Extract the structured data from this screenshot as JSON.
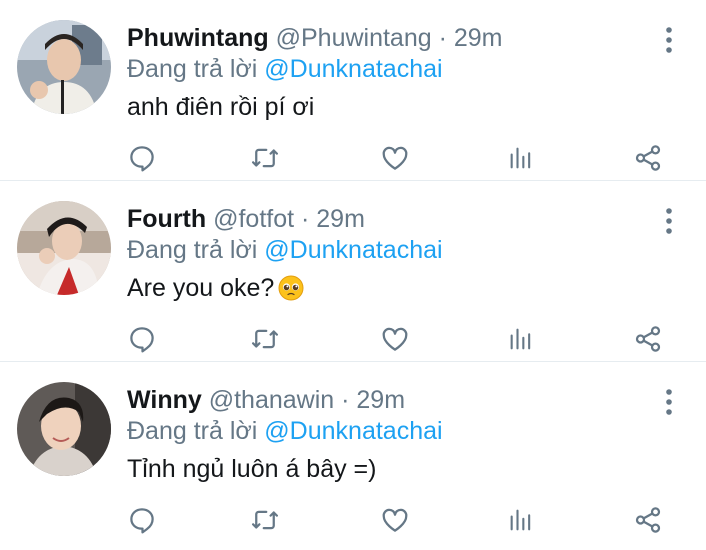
{
  "reply_prefix": "Đang trả lời",
  "tweets": [
    {
      "name": "Phuwintang",
      "meta": "@Phuwintang · 29m",
      "reply_to": "@Dunknatachai",
      "text": "anh điên rồi pí ơi",
      "emoji": ""
    },
    {
      "name": "Fourth",
      "meta": "@fotfot · 29m",
      "reply_to": "@Dunknatachai",
      "text": "Are you oke?",
      "emoji": "pleading-face"
    },
    {
      "name": "Winny",
      "meta": "@thanawin · 29m",
      "reply_to": "@Dunknatachai",
      "text": "Tỉnh ngủ luôn á bây =)",
      "emoji": ""
    }
  ],
  "icons": {
    "reply": "reply-icon",
    "retweet": "retweet-icon",
    "like": "heart-icon",
    "stats": "stats-icon",
    "share": "share-icon",
    "more": "more-vertical-icon"
  },
  "colors": {
    "name": "#14171a",
    "secondary": "#657786",
    "mention": "#1da1f2",
    "divider": "#e6ecf0"
  }
}
